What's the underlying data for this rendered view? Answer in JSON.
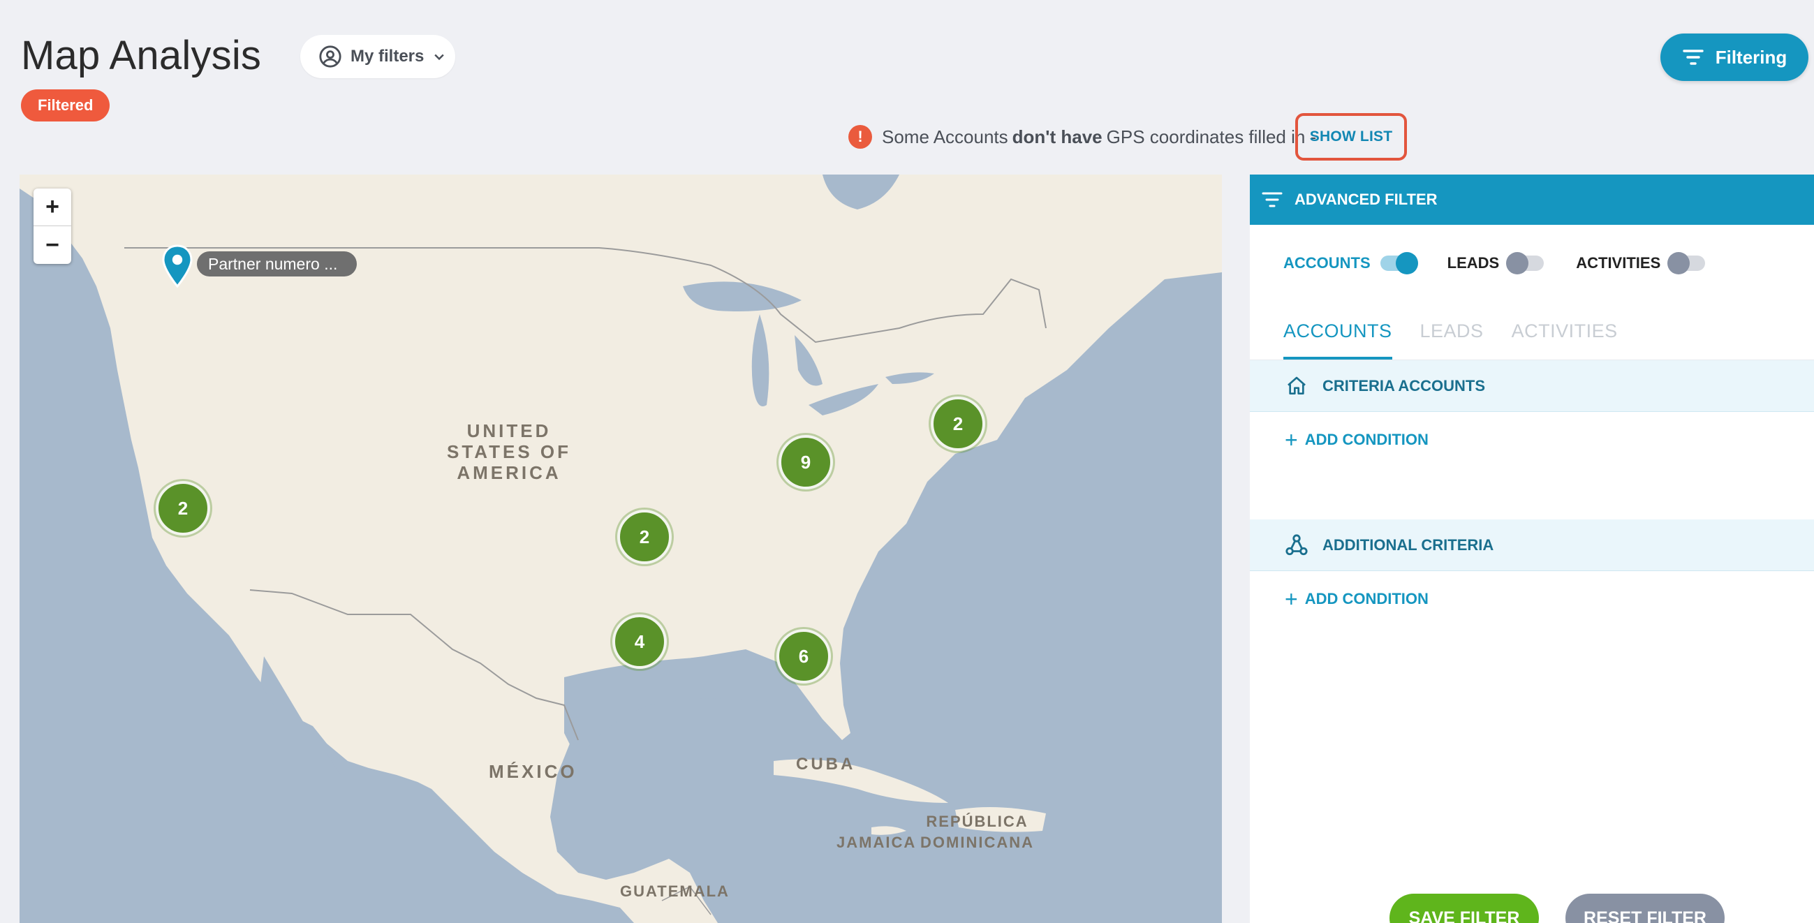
{
  "header": {
    "title": "Map Analysis",
    "filtered_badge": "Filtered",
    "my_filters_label": "My filters",
    "filtering_label": "Filtering"
  },
  "notice": {
    "icon": "!",
    "text_before": "Some Accounts",
    "text_bold": "don't have",
    "text_after": "GPS coordinates filled in -",
    "show_list_label": "SHOW LIST"
  },
  "map": {
    "zoom_in": "+",
    "zoom_out": "−",
    "labels": {
      "usa": "UNITED\nSTATES OF\nAMERICA",
      "mexico": "MÉXICO",
      "cuba": "CUBA",
      "jamaica": "JAMAICA",
      "dominicana": "REPÚBLICA\nDOMINICANA",
      "guatemala": "GUATEMALA"
    },
    "pin_label": "Partner numero ...",
    "clusters": [
      {
        "id": "california",
        "count": "2"
      },
      {
        "id": "missouri",
        "count": "2"
      },
      {
        "id": "ohio",
        "count": "9"
      },
      {
        "id": "new-york",
        "count": "2"
      },
      {
        "id": "texas",
        "count": "4"
      },
      {
        "id": "florida",
        "count": "6"
      }
    ]
  },
  "panel": {
    "title": "ADVANCED FILTER",
    "toggles": [
      {
        "label": "ACCOUNTS",
        "on": true
      },
      {
        "label": "LEADS",
        "on": false
      },
      {
        "label": "ACTIVITIES",
        "on": false
      }
    ],
    "tabs": [
      "ACCOUNTS",
      "LEADS",
      "ACTIVITIES"
    ],
    "criteria_accounts": "CRITERIA ACCOUNTS",
    "additional_criteria": "ADDITIONAL CRITERIA",
    "add_condition": "ADD CONDITION",
    "save_filter": "SAVE FILTER",
    "reset_filter": "RESET FILTER"
  },
  "colors": {
    "accent": "#1596c0",
    "badge": "#ef5a3d",
    "cluster": "#5a9229",
    "save": "#5fb51c",
    "reset": "#8891a3"
  }
}
